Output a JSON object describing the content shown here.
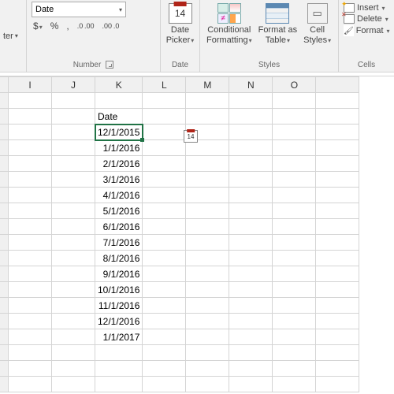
{
  "ribbon": {
    "paste_trailing": "ter",
    "number": {
      "format_select": "Date",
      "currency": "$",
      "percent": "%",
      "comma": ",",
      "inc_dec_1": ".0 .00",
      "inc_dec_2": ".00 .0",
      "label": "Number"
    },
    "date_group": {
      "cal_day": "14",
      "button": "Date\nPicker",
      "label": "Date"
    },
    "styles": {
      "cond": "Conditional\nFormatting",
      "table": "Format as\nTable",
      "cell": "Cell\nStyles",
      "ne_sym": "≠",
      "label": "Styles"
    },
    "cells": {
      "insert": "Insert",
      "delete": "Delete",
      "format": "Format",
      "label": "Cells"
    }
  },
  "sheet": {
    "columns": [
      "I",
      "J",
      "K",
      "L",
      "M",
      "N",
      "O"
    ],
    "header_text": "Date",
    "active_value": "12/1/2015",
    "dates": [
      "1/1/2016",
      "2/1/2016",
      "3/1/2016",
      "4/1/2016",
      "5/1/2016",
      "6/1/2016",
      "7/1/2016",
      "8/1/2016",
      "9/1/2016",
      "10/1/2016",
      "11/1/2016",
      "12/1/2016",
      "1/1/2017"
    ],
    "mini_cal": "14"
  }
}
